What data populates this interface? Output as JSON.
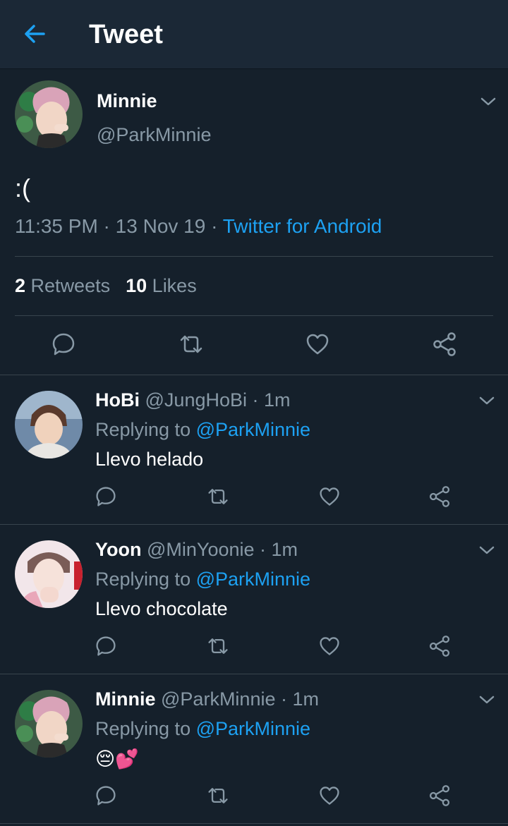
{
  "header": {
    "title": "Tweet"
  },
  "tweet": {
    "name": "Minnie",
    "handle": "@ParkMinnie",
    "text": ":(",
    "time": "11:35 PM",
    "date": "13 Nov 19",
    "separator": " · ",
    "source": "Twitter for Android",
    "retweets_count": "2",
    "retweets_label": "Retweets",
    "likes_count": "10",
    "likes_label": "Likes"
  },
  "replies": [
    {
      "name": "HoBi",
      "handle": "@JungHoBi",
      "time": "1m",
      "replying_prefix": "Replying to ",
      "replying_to": "@ParkMinnie",
      "text": "Llevo helado"
    },
    {
      "name": "Yoon",
      "handle": "@MinYoonie",
      "time": "1m",
      "replying_prefix": "Replying to ",
      "replying_to": "@ParkMinnie",
      "text": "Llevo chocolate"
    },
    {
      "name": "Minnie",
      "handle": "@ParkMinnie",
      "time": "1m",
      "replying_prefix": "Replying to ",
      "replying_to": "@ParkMinnie",
      "text": "😔💕"
    }
  ],
  "icons": {
    "back": "arrow-left-icon",
    "menu": "chevron-down-icon",
    "reply": "reply-icon",
    "retweet": "retweet-icon",
    "like": "heart-icon",
    "share": "share-icon"
  },
  "colors": {
    "background": "#15202b",
    "header": "#1b2836",
    "accent": "#1da1f2",
    "secondary_text": "#8899a6",
    "divider": "#38444d"
  }
}
